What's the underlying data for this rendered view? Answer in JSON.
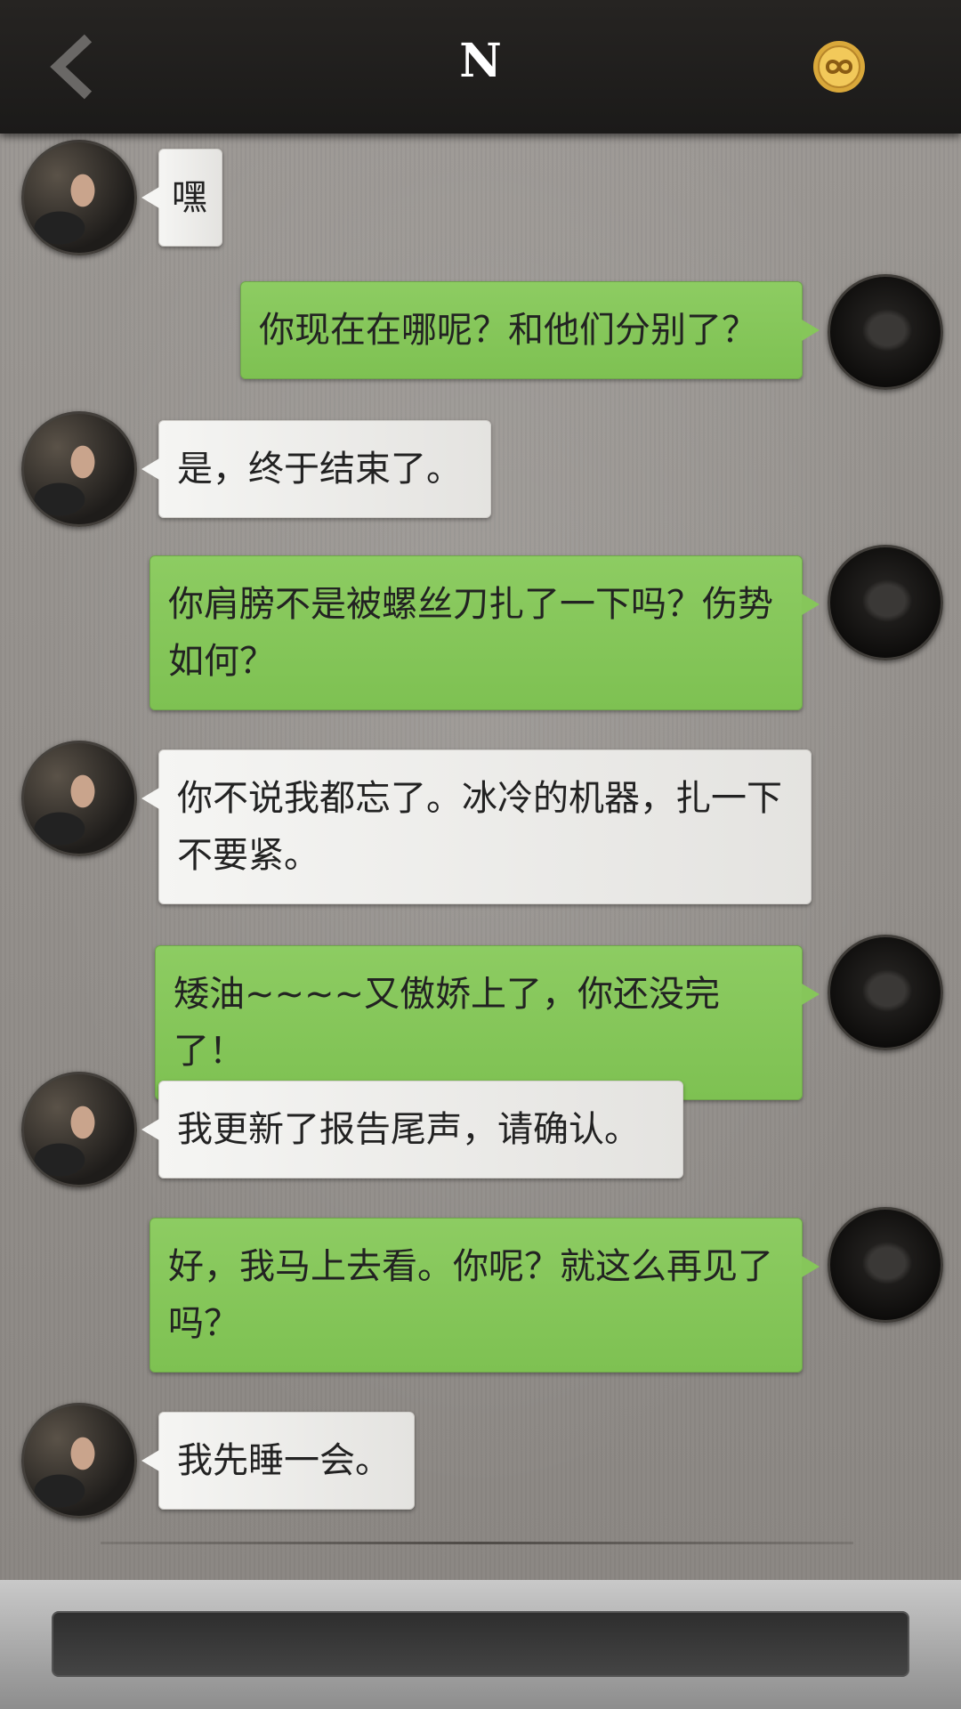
{
  "header": {
    "title": "N",
    "back_icon": "chevron-left-icon",
    "coin_icon": "infinity-coin-icon"
  },
  "messages": [
    {
      "side": "friend",
      "text": "嘿"
    },
    {
      "side": "me",
      "text": "你现在在哪呢？和他们分别了？"
    },
    {
      "side": "friend",
      "text": "是，终于结束了。"
    },
    {
      "side": "me",
      "text": "你肩膀不是被螺丝刀扎了一下吗？伤势如何？"
    },
    {
      "side": "friend",
      "text": "你不说我都忘了。冰冷的机器，扎一下不要紧。"
    },
    {
      "side": "me",
      "text": "矮油~~~~又傲娇上了，你还没完了！"
    },
    {
      "side": "friend",
      "text": "我更新了报告尾声，请确认。"
    },
    {
      "side": "me",
      "text": "好，我马上去看。你呢？就这么再见了吗？"
    },
    {
      "side": "friend",
      "text": "我先睡一会。"
    }
  ],
  "input": {
    "placeholder": "",
    "value": ""
  },
  "colors": {
    "header_bg": "#1f1e1d",
    "outgoing_bubble": "#86c65a",
    "incoming_bubble": "#efeeec",
    "coin": "#e8b640"
  }
}
